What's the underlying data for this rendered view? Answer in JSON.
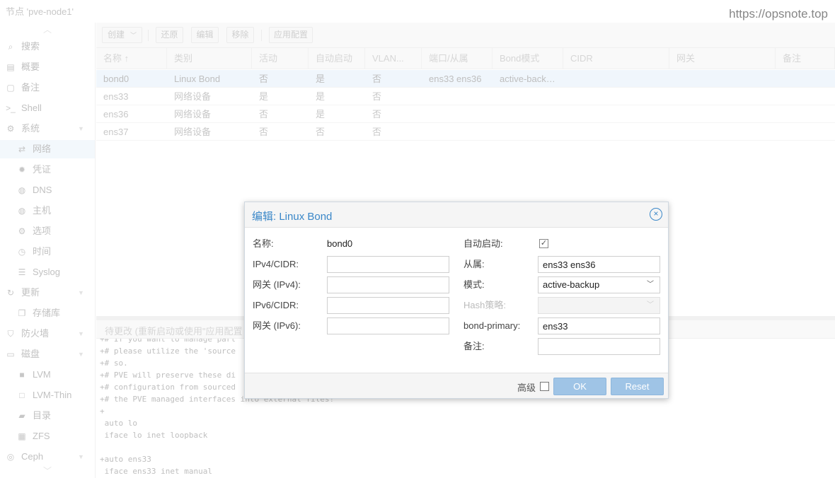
{
  "header": {
    "node_title": "节点 'pve-node1'",
    "watermark": "https://opsnote.top"
  },
  "sidebar": {
    "items": [
      {
        "icon": "search-icon",
        "glyph": "⌕",
        "label": "搜索",
        "level": 0
      },
      {
        "icon": "book-icon",
        "glyph": "▤",
        "label": "概要",
        "level": 0
      },
      {
        "icon": "notes-icon",
        "glyph": "▢",
        "label": "备注",
        "level": 0
      },
      {
        "icon": "terminal-icon",
        "glyph": ">_",
        "label": "Shell",
        "level": 0
      },
      {
        "icon": "gears-icon",
        "glyph": "⚙",
        "label": "系统",
        "level": 0,
        "expandable": true
      },
      {
        "icon": "network-icon",
        "glyph": "⇄",
        "label": "网络",
        "level": 1,
        "selected": true
      },
      {
        "icon": "certificate-icon",
        "glyph": "✹",
        "label": "凭证",
        "level": 1
      },
      {
        "icon": "globe-icon",
        "glyph": "◍",
        "label": "DNS",
        "level": 1
      },
      {
        "icon": "globe-icon",
        "glyph": "◍",
        "label": "主机",
        "level": 1
      },
      {
        "icon": "gear-icon",
        "glyph": "⚙",
        "label": "选项",
        "level": 1
      },
      {
        "icon": "clock-icon",
        "glyph": "◷",
        "label": "时间",
        "level": 1
      },
      {
        "icon": "list-icon",
        "glyph": "☰",
        "label": "Syslog",
        "level": 1
      },
      {
        "icon": "refresh-icon",
        "glyph": "↻",
        "label": "更新",
        "level": 0,
        "expandable": true
      },
      {
        "icon": "copy-icon",
        "glyph": "❐",
        "label": "存储库",
        "level": 1
      },
      {
        "icon": "shield-icon",
        "glyph": "⛉",
        "label": "防火墙",
        "level": 0,
        "expandable": true
      },
      {
        "icon": "hdd-icon",
        "glyph": "▭",
        "label": "磁盘",
        "level": 0,
        "expandable": true
      },
      {
        "icon": "square-icon",
        "glyph": "■",
        "label": "LVM",
        "level": 1
      },
      {
        "icon": "square-outline-icon",
        "glyph": "□",
        "label": "LVM-Thin",
        "level": 1
      },
      {
        "icon": "folder-icon",
        "glyph": "▰",
        "label": "目录",
        "level": 1
      },
      {
        "icon": "grid-icon",
        "glyph": "▦",
        "label": "ZFS",
        "level": 1
      },
      {
        "icon": "ceph-icon",
        "glyph": "◎",
        "label": "Ceph",
        "level": 0,
        "expandable": true
      }
    ]
  },
  "toolbar": {
    "create_label": "创建",
    "revert_label": "还原",
    "edit_label": "编辑",
    "remove_label": "移除",
    "apply_label": "应用配置"
  },
  "grid": {
    "columns": [
      "名称 ↑",
      "类别",
      "活动",
      "自动启动",
      "VLAN...",
      "端口/从属",
      "Bond模式",
      "CIDR",
      "网关",
      "备注"
    ],
    "rows": [
      {
        "name": "bond0",
        "type": "Linux Bond",
        "active": "否",
        "autostart": "是",
        "vlan": "否",
        "ports": "ens33 ens36",
        "bond_mode": "active-back…",
        "cidr": "",
        "gateway": "",
        "comment": "",
        "selected": true
      },
      {
        "name": "ens33",
        "type": "网络设备",
        "active": "是",
        "autostart": "是",
        "vlan": "否",
        "ports": "",
        "bond_mode": "",
        "cidr": "",
        "gateway": "",
        "comment": ""
      },
      {
        "name": "ens36",
        "type": "网络设备",
        "active": "否",
        "autostart": "是",
        "vlan": "否",
        "ports": "",
        "bond_mode": "",
        "cidr": "",
        "gateway": "",
        "comment": ""
      },
      {
        "name": "ens37",
        "type": "网络设备",
        "active": "否",
        "autostart": "否",
        "vlan": "否",
        "ports": "",
        "bond_mode": "",
        "cidr": "",
        "gateway": "",
        "comment": ""
      }
    ]
  },
  "pending": {
    "title": "待更改 (重新启动或使用\"应用配置",
    "lines": [
      "+# If you want to manage part",
      "+# please utilize the 'source",
      "+# so.",
      "+# PVE will preserve these di",
      "+# configuration from sourced",
      "+# the PVE managed interfaces into external files!",
      "+",
      " auto lo",
      " iface lo inet loopback",
      "",
      "+auto ens33",
      " iface ens33 inet manual"
    ]
  },
  "dialog": {
    "title": "编辑: Linux Bond",
    "name_label": "名称:",
    "name_value": "bond0",
    "ipv4_label": "IPv4/CIDR:",
    "ipv4_value": "",
    "gw4_label": "网关 (IPv4):",
    "gw4_value": "",
    "ipv6_label": "IPv6/CIDR:",
    "ipv6_value": "",
    "gw6_label": "网关 (IPv6):",
    "gw6_value": "",
    "autostart_label": "自动启动:",
    "autostart_checked": true,
    "slaves_label": "从属:",
    "slaves_value": "ens33 ens36",
    "mode_label": "模式:",
    "mode_value": "active-backup",
    "hash_label": "Hash策略:",
    "hash_value": "",
    "primary_label": "bond-primary:",
    "primary_value": "ens33",
    "comment_label": "备注:",
    "comment_value": "",
    "advanced_label": "高级",
    "ok_label": "OK",
    "reset_label": "Reset"
  }
}
